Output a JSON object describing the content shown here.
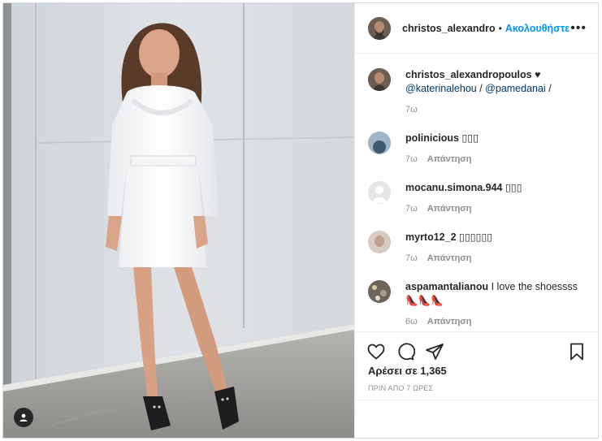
{
  "header": {
    "username": "christos_alexandro",
    "separator": "•",
    "follow_label": "Ακολουθήστε",
    "more_label": "•••"
  },
  "caption": {
    "username": "christos_alexandropoulos",
    "text": " ♥",
    "mention1": "@katerinalehou",
    "sep": " / ",
    "mention2": "@pamedanai",
    "tail": " /",
    "time": "7ω"
  },
  "comments": [
    {
      "username": "polinicious",
      "text": " ▯▯▯",
      "time": "7ω",
      "reply": "Απάντηση",
      "avatar_color": "#6f8fa8"
    },
    {
      "username": "mocanu.simona.944",
      "text": " ▯▯▯",
      "time": "7ω",
      "reply": "Απάντηση",
      "avatar_color": "#dcdcdc"
    },
    {
      "username": "myrto12_2",
      "text": " ▯▯▯▯▯▯",
      "time": "7ω",
      "reply": "Απάντηση",
      "avatar_color": "#c9b8ad"
    },
    {
      "username": "aspamantalianou",
      "text": " I love the shoessss 👠👠👠",
      "time": "6ω",
      "reply": "Απάντηση",
      "avatar_color": "#7d7466"
    }
  ],
  "likes": "Αρέσει σε 1,365",
  "time_ago": "ΠΡΙΝ ΑΠΟ 7 ΩΡΕΣ",
  "icons": {
    "like": "heart-icon",
    "comment": "comment-icon",
    "share": "send-icon",
    "save": "bookmark-icon",
    "tag": "user-tag-icon"
  },
  "colors": {
    "accent": "#0095f6",
    "muted": "#8e8e8e",
    "text": "#262626",
    "mention": "#00376b"
  }
}
